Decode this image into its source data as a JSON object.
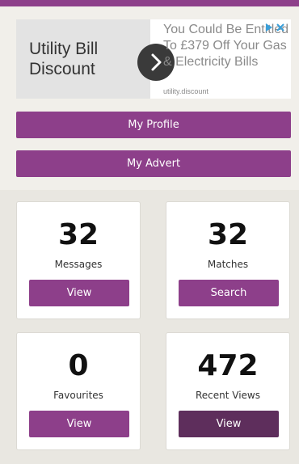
{
  "ad": {
    "headline": "Utility Bill Discount",
    "body": "You Could Be Entitled To £379 Off Your Gas & Electricity Bills",
    "domain": "utility.discount",
    "arrow_icon": "chevron-right-icon",
    "choices_icon": "adchoices-icon"
  },
  "buttons": {
    "my_profile": "My Profile",
    "my_advert": "My Advert"
  },
  "stats": {
    "messages": {
      "count": "32",
      "label": "Messages",
      "action": "View"
    },
    "matches": {
      "count": "32",
      "label": "Matches",
      "action": "Search"
    },
    "favourites": {
      "count": "0",
      "label": "Favourites",
      "action": "View"
    },
    "recent_views": {
      "count": "472",
      "label": "Recent Views",
      "action": "View"
    }
  },
  "colors": {
    "brand": "#8d3f8a",
    "brand_dark": "#5e2e5c",
    "background": "#e9e7e1"
  }
}
